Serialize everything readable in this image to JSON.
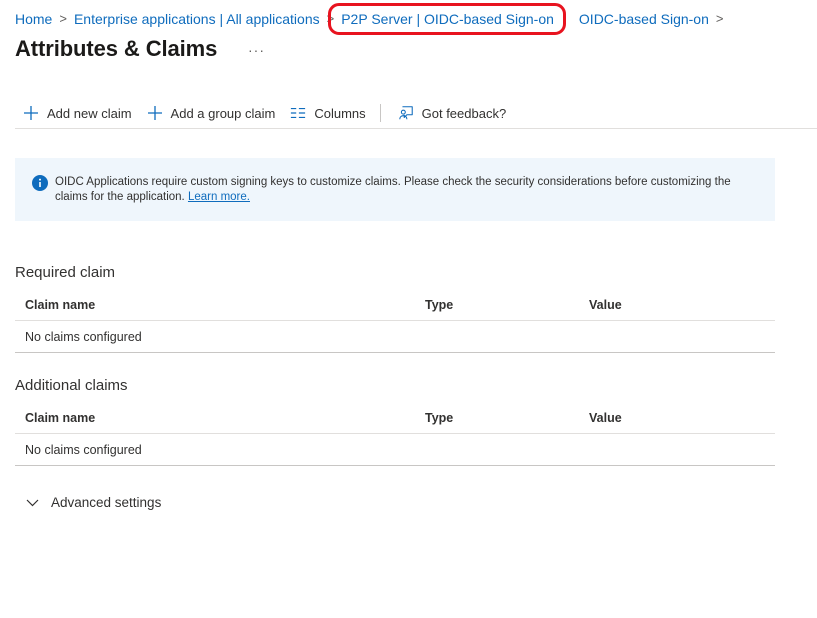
{
  "breadcrumb": {
    "items": [
      {
        "label": "Home"
      },
      {
        "label": "Enterprise applications | All applications"
      },
      {
        "label": "P2P Server | OIDC-based Sign-on"
      },
      {
        "label": "OIDC-based Sign-on"
      }
    ],
    "separator": ">"
  },
  "header": {
    "title": "Attributes & Claims",
    "more_label": "···"
  },
  "toolbar": {
    "add_new_claim": "Add new claim",
    "add_group_claim": "Add a group claim",
    "columns": "Columns",
    "feedback": "Got feedback?",
    "icons": {
      "add_new_claim": "plus-icon",
      "add_group_claim": "plus-icon",
      "columns": "columns-icon",
      "feedback": "feedback-icon"
    }
  },
  "info_bar": {
    "text": "OIDC Applications require custom signing keys to customize claims. Please check the security considerations before customizing the claims for the application.",
    "link": "Learn more.",
    "icon": "info-icon"
  },
  "required_claims": {
    "title": "Required claim",
    "columns": [
      "Claim name",
      "Type",
      "Value"
    ],
    "empty_text": "No claims configured"
  },
  "additional_claims": {
    "title": "Additional claims",
    "columns": [
      "Claim name",
      "Type",
      "Value"
    ],
    "empty_text": "No claims configured"
  },
  "advanced_settings": {
    "label": "Advanced settings",
    "icon": "chevron-down-icon"
  },
  "colors": {
    "link": "#0f6cbd",
    "highlight_border": "#e8131f",
    "info_background": "#eff6fc",
    "info_icon": "#0f6cbd"
  }
}
